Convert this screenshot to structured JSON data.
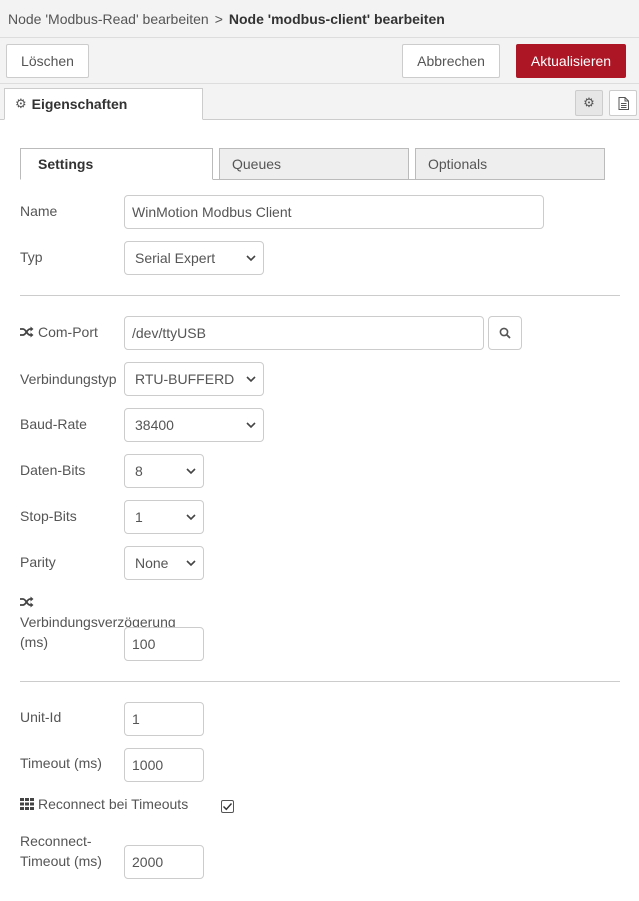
{
  "breadcrumb": {
    "parent": "Node 'Modbus-Read' bearbeiten",
    "separator": ">",
    "current": "Node 'modbus-client' bearbeiten"
  },
  "actions": {
    "delete_label": "Löschen",
    "cancel_label": "Abbrechen",
    "update_label": "Aktualisieren"
  },
  "tabs": {
    "properties_label": "Eigenschaften"
  },
  "subtabs": {
    "settings": "Settings",
    "queues": "Queues",
    "optionals": "Optionals"
  },
  "form": {
    "name_label": "Name",
    "name_value": "WinMotion Modbus Client",
    "type_label": "Typ",
    "type_value": "Serial Expert",
    "comport_label": "Com-Port",
    "comport_value": "/dev/ttyUSB",
    "conntype_label": "Verbindungstyp",
    "conntype_value": "RTU-BUFFERD",
    "baud_label": "Baud-Rate",
    "baud_value": "38400",
    "databits_label": "Daten-Bits",
    "databits_value": "8",
    "stopbits_label": "Stop-Bits",
    "stopbits_value": "1",
    "parity_label": "Parity",
    "parity_value": "None",
    "delay_label_line1": "Verbindungsverzögerung",
    "delay_label_line2": "(ms)",
    "delay_value": "100",
    "unitid_label": "Unit-Id",
    "unitid_value": "1",
    "timeout_label": "Timeout (ms)",
    "timeout_value": "1000",
    "reconnect_label": "Reconnect bei Timeouts",
    "reconnect_checked": true,
    "reconnect_timeout_label_line1": "Reconnect-",
    "reconnect_timeout_label_line2": "Timeout (ms)",
    "reconnect_timeout_value": "2000"
  },
  "colors": {
    "primary": "#AD1625",
    "toolbar_bg": "#f3f3f3",
    "border": "#cccccc"
  },
  "icons": {
    "properties_tab": "gear-icon",
    "settings_button": "gear-icon",
    "description_button": "document-icon",
    "comport": "shuffle-icon",
    "delay": "shuffle-icon",
    "comport_search": "search-icon",
    "reconnect": "grid-icon"
  }
}
